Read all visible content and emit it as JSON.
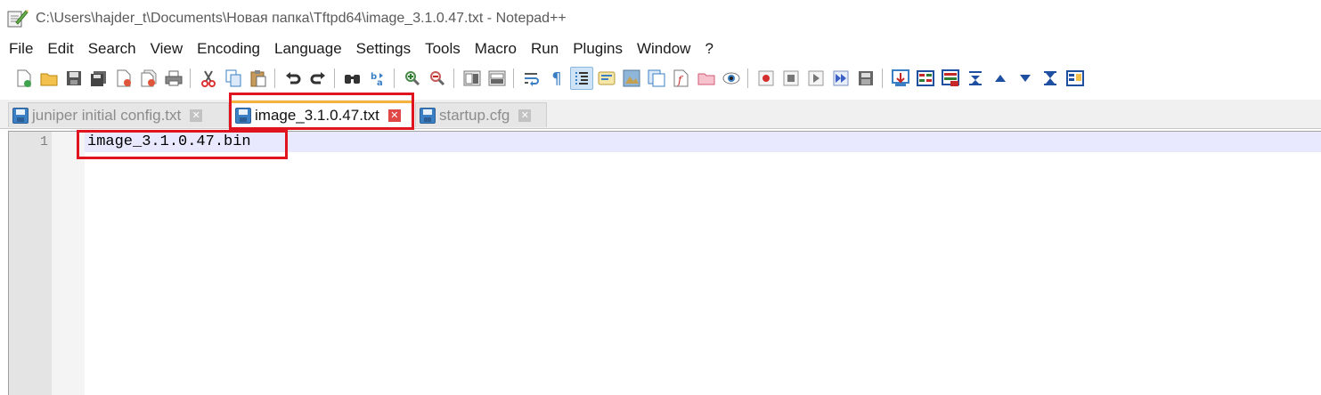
{
  "window": {
    "title": "C:\\Users\\hajder_t\\Documents\\Новая папка\\Tftpd64\\image_3.1.0.47.txt - Notepad++"
  },
  "menu": [
    "File",
    "Edit",
    "Search",
    "View",
    "Encoding",
    "Language",
    "Settings",
    "Tools",
    "Macro",
    "Run",
    "Plugins",
    "Window",
    "?"
  ],
  "tabs": [
    {
      "label": "juniper initial config.txt",
      "state": "inactive"
    },
    {
      "label": "image_3.1.0.47.txt",
      "state": "active"
    },
    {
      "label": "startup.cfg",
      "state": "inactive"
    }
  ],
  "editor": {
    "line_numbers": [
      "1"
    ],
    "lines": [
      "image_3.1.0.47.bin"
    ]
  },
  "colors": {
    "highlight": "#e0141e",
    "active_tab_accent": "#f7b13f",
    "current_line": "#e8e8ff"
  },
  "toolbar_icons": [
    "new-file-icon",
    "open-file-icon",
    "save-icon",
    "save-all-icon",
    "close-icon",
    "close-all-icon",
    "print-icon",
    "cut-icon",
    "copy-icon",
    "paste-icon",
    "undo-icon",
    "redo-icon",
    "find-icon",
    "replace-icon",
    "zoom-in-icon",
    "zoom-out-icon",
    "sync-v-icon",
    "sync-h-icon",
    "word-wrap-icon",
    "show-all-chars-icon",
    "indent-guide-icon",
    "udl-icon",
    "doc-map-icon",
    "doc-list-icon",
    "function-list-icon",
    "folder-workspace-icon",
    "monitoring-icon",
    "record-macro-icon",
    "stop-record-icon",
    "play-macro-icon",
    "run-macro-multiple-icon",
    "save-macro-icon",
    "plugin-icon-1",
    "plugin-icon-2",
    "plugin-icon-3",
    "plugin-icon-4",
    "plugin-icon-5",
    "plugin-icon-6",
    "plugin-icon-7",
    "plugin-icon-8"
  ]
}
